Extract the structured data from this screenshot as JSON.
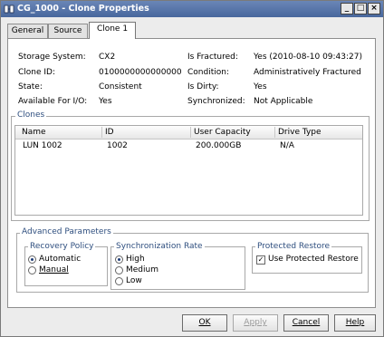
{
  "window": {
    "title": "CG_1000 - Clone Properties",
    "controls": {
      "minimize": "_",
      "maximize": "□",
      "close": "×"
    }
  },
  "tabs": [
    {
      "label": "General",
      "active": false
    },
    {
      "label": "Source",
      "active": false
    },
    {
      "label": "Clone 1",
      "active": true
    }
  ],
  "properties": {
    "storage_system": {
      "label": "Storage System:",
      "value": "CX2"
    },
    "clone_id": {
      "label": "Clone ID:",
      "value": "0100000000000000"
    },
    "state": {
      "label": "State:",
      "value": "Consistent"
    },
    "available_for_io": {
      "label": "Available For I/O:",
      "value": "Yes"
    },
    "is_fractured": {
      "label": "Is Fractured:",
      "value": "Yes (2010-08-10 09:43:27)"
    },
    "condition": {
      "label": "Condition:",
      "value": "Administratively Fractured"
    },
    "is_dirty": {
      "label": "Is Dirty:",
      "value": "Yes"
    },
    "synchronized": {
      "label": "Synchronized:",
      "value": "Not Applicable"
    }
  },
  "clones": {
    "group_title": "Clones",
    "columns": [
      "Name",
      "ID",
      "User Capacity",
      "Drive Type"
    ],
    "rows": [
      {
        "name": "LUN 1002",
        "id": "1002",
        "user_capacity": "200.000GB",
        "drive_type": "N/A"
      }
    ]
  },
  "advanced": {
    "group_title": "Advanced Parameters",
    "recovery_policy": {
      "title": "Recovery Policy",
      "options": [
        {
          "label": "Automatic",
          "selected": true
        },
        {
          "label": "Manual",
          "selected": false
        }
      ]
    },
    "sync_rate": {
      "title": "Synchronization Rate",
      "options": [
        {
          "label": "High",
          "selected": true
        },
        {
          "label": "Medium",
          "selected": false
        },
        {
          "label": "Low",
          "selected": false
        }
      ]
    },
    "protected_restore": {
      "title": "Protected Restore",
      "checkbox_label": "Use Protected Restore",
      "checked": true
    }
  },
  "buttons": {
    "ok": "OK",
    "apply": "Apply",
    "cancel": "Cancel",
    "help": "Help"
  },
  "colors": {
    "titlebar": "#48679d",
    "group_title": "#2f4f7f"
  }
}
